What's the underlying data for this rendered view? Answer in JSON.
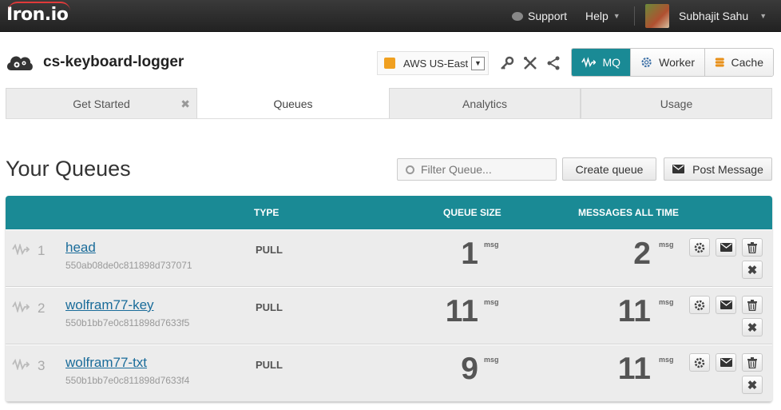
{
  "topbar": {
    "logo": "Iron.io",
    "support": "Support",
    "help": "Help",
    "user": "Subhajit Sahu"
  },
  "project": {
    "name": "cs-keyboard-logger",
    "region": "AWS US-East"
  },
  "products": [
    {
      "label": "MQ",
      "icon": "mq-wave-icon"
    },
    {
      "label": "Worker",
      "icon": "gear-icon"
    },
    {
      "label": "Cache",
      "icon": "database-icon"
    }
  ],
  "tabs": [
    "Get Started",
    "Queues",
    "Analytics",
    "Usage"
  ],
  "page": {
    "title": "Your Queues",
    "filter_placeholder": "Filter Queue...",
    "create_queue": "Create queue",
    "post_message": "Post Message"
  },
  "table": {
    "headers": {
      "type": "TYPE",
      "queue_size": "QUEUE SIZE",
      "messages_all_time": "MESSAGES ALL TIME"
    },
    "unit": "msg",
    "rows": [
      {
        "index": "1",
        "name": "head",
        "id": "550ab08de0c811898d737071",
        "type": "PULL",
        "size": "1",
        "total": "2"
      },
      {
        "index": "2",
        "name": "wolfram77-key",
        "id": "550b1bb7e0c811898d7633f5",
        "type": "PULL",
        "size": "11",
        "total": "11"
      },
      {
        "index": "3",
        "name": "wolfram77-txt",
        "id": "550b1bb7e0c811898d7633f4",
        "type": "PULL",
        "size": "9",
        "total": "11"
      }
    ]
  }
}
